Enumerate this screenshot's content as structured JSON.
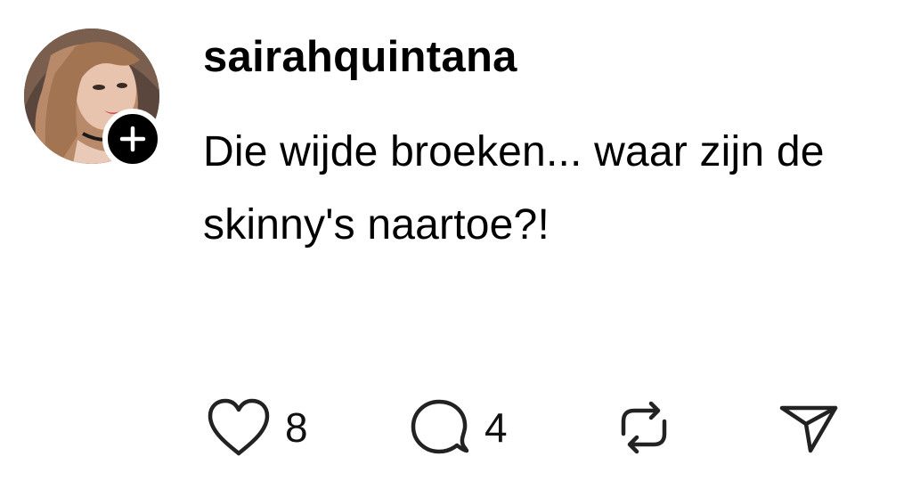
{
  "post": {
    "username": "sairahquintana",
    "text": "Die wijde broeken... waar zijn de skinny's naartoe?!",
    "avatar_icon": "profile-photo",
    "follow_icon": "plus-icon"
  },
  "actions": {
    "like": {
      "icon": "heart-icon",
      "count": "8"
    },
    "reply": {
      "icon": "comment-bubble-icon",
      "count": "4"
    },
    "repost": {
      "icon": "repost-icon"
    },
    "share": {
      "icon": "send-icon"
    }
  },
  "colors": {
    "text": "#000000",
    "background": "#ffffff",
    "badge": "#000000"
  }
}
